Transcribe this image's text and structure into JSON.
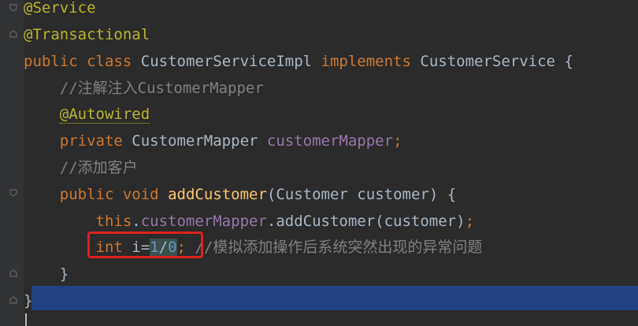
{
  "colors": {
    "background": "#2b2b2b",
    "keyword": "#cc7832",
    "annotation": "#bbb529",
    "comment": "#808080",
    "field": "#9876aa",
    "method": "#ffc66d",
    "number": "#6897bb",
    "current_line": "#214283",
    "highlight_box": "#e02020"
  },
  "code": {
    "l1": {
      "annotation": "@Service"
    },
    "l2": {
      "annotation": "@Transactional"
    },
    "l3": {
      "kw_public": "public",
      "kw_class": "class",
      "class_name": "CustomerServiceImpl",
      "kw_implements": "implements",
      "iface": "CustomerService",
      "brace": "{"
    },
    "l4": {
      "comment": "//注解注入CustomerMapper"
    },
    "l5": {
      "annotation": "@Autowired"
    },
    "l6": {
      "kw_private": "private",
      "type": "CustomerMapper",
      "field": "customerMapper",
      "semi": ";"
    },
    "l7": {
      "comment": "//添加客户"
    },
    "l8": {
      "kw_public": "public",
      "kw_void": "void",
      "method": "addCustomer",
      "params": "(Customer customer) {"
    },
    "l9": {
      "kw_this": "this",
      "dot1": ".",
      "field": "customerMapper",
      "call": ".addCustomer(customer)",
      "semi": ";"
    },
    "l10": {
      "kw_int": "int",
      "decl": " i=",
      "num1": "1",
      "slash": "/",
      "num0": "0",
      "semi": ";",
      "comment": "//模拟添加操作后系统突然出现的异常问题"
    },
    "l11": {
      "brace": "}"
    },
    "l12": {
      "brace": "}"
    }
  }
}
